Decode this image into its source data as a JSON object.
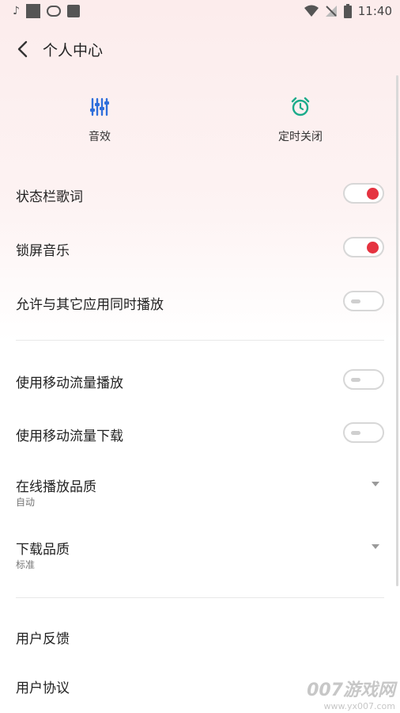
{
  "status_bar": {
    "time": "11:40"
  },
  "header": {
    "title": "个人中心"
  },
  "quick_actions": [
    {
      "label": "音效",
      "icon": "equalizer-icon",
      "color": "#2f6fdb"
    },
    {
      "label": "定时关闭",
      "icon": "alarm-clock-icon",
      "color": "#1aab8a"
    }
  ],
  "settings": {
    "status_bar_lyrics": {
      "label": "状态栏歌词",
      "enabled": true
    },
    "lockscreen_music": {
      "label": "锁屏音乐",
      "enabled": true
    },
    "allow_concurrent_playback": {
      "label": "允许与其它应用同时播放",
      "enabled": false
    },
    "mobile_data_playback": {
      "label": "使用移动流量播放",
      "enabled": false
    },
    "mobile_data_download": {
      "label": "使用移动流量下载",
      "enabled": false
    },
    "online_quality": {
      "label": "在线播放品质",
      "value": "自动"
    },
    "download_quality": {
      "label": "下载品质",
      "value": "标准"
    }
  },
  "links": {
    "feedback": "用户反馈",
    "agreement": "用户协议"
  },
  "watermark": {
    "title": "007游戏网",
    "url": "www.yx007.com"
  },
  "colors": {
    "accent": "#e53340",
    "background_top": "#fcecec"
  }
}
